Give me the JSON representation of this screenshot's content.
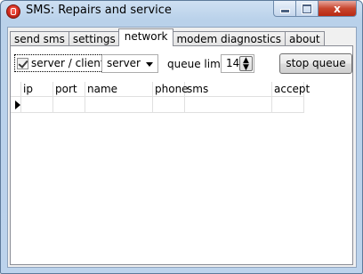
{
  "window": {
    "title": "SMS: Repairs and service",
    "controls": {
      "minimize": "",
      "maximize": "",
      "close": "x"
    }
  },
  "tabs": [
    {
      "label": "send sms",
      "active": false
    },
    {
      "label": "settings",
      "active": false
    },
    {
      "label": "network",
      "active": true
    },
    {
      "label": "modem diagnostics",
      "active": false
    },
    {
      "label": "about",
      "active": false
    }
  ],
  "network": {
    "server_client_checkbox": {
      "label": "server / client",
      "checked": true
    },
    "mode_select": {
      "value": "server"
    },
    "queue_limit": {
      "label": "queue limit",
      "value": "14"
    },
    "stop_queue_button": "stop queue",
    "table": {
      "columns": [
        "ip",
        "port",
        "name",
        "phone",
        "sms",
        "accept"
      ],
      "rows": [
        [
          "",
          "",
          "",
          "",
          "",
          ""
        ]
      ]
    }
  }
}
